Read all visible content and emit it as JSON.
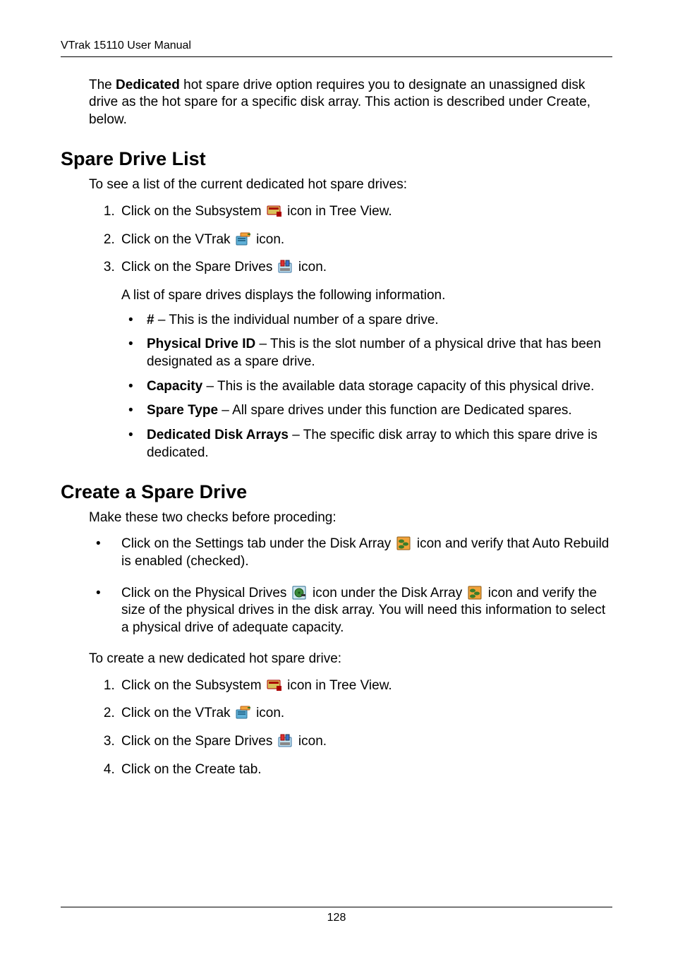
{
  "header": {
    "running_head": "VTrak 15110 User Manual"
  },
  "intro_para": {
    "text_before_bold": "The ",
    "bold": "Dedicated",
    "text_after_bold": " hot spare drive option requires you to designate an unassigned disk drive as the hot spare for a specific disk array. This action is described under Create, below."
  },
  "section1": {
    "heading": "Spare Drive List",
    "intro": "To see a list of the current dedicated hot spare drives:",
    "steps": [
      {
        "before": "Click on the Subsystem ",
        "icon": "subsystem-icon",
        "after": " icon in Tree View."
      },
      {
        "before": "Click on the VTrak ",
        "icon": "vtrak-icon",
        "after": " icon."
      },
      {
        "before": "Click on the Spare Drives ",
        "icon": "spare-drives-icon",
        "after": " icon."
      }
    ],
    "sub_para": "A list of spare drives displays the following information.",
    "bullets": [
      {
        "bold": "#",
        "rest": " – This is the individual number of a spare drive."
      },
      {
        "bold": "Physical Drive ID",
        "rest": " – This is the slot number of a physical drive that has been designated as a spare drive."
      },
      {
        "bold": "Capacity",
        "rest": " – This is the available data storage capacity of this physical drive."
      },
      {
        "bold": "Spare Type",
        "rest": " – All spare drives under this function are Dedicated spares."
      },
      {
        "bold": "Dedicated Disk Arrays",
        "rest": " – The specific disk array to which this spare drive is dedicated."
      }
    ]
  },
  "section2": {
    "heading": "Create a Spare Drive",
    "intro": "Make these two checks before proceding:",
    "checks": [
      {
        "seg1": "Click on the Settings tab under the Disk Array ",
        "icon1": "disk-array-icon",
        "seg2": " icon and verify that Auto Rebuild is enabled (checked)."
      },
      {
        "seg1": "Click on the Physical Drives ",
        "icon1": "physical-drives-icon",
        "seg2": " icon under the Disk Array ",
        "icon2": "disk-array-icon",
        "seg3": " icon and verify the size of the physical drives in the disk array. You will need this information to select a physical drive of adequate capacity."
      }
    ],
    "intro2": "To create a new dedicated hot spare drive:",
    "steps": [
      {
        "before": "Click on the Subsystem ",
        "icon": "subsystem-icon",
        "after": " icon in Tree View."
      },
      {
        "before": "Click on the VTrak ",
        "icon": "vtrak-icon",
        "after": " icon."
      },
      {
        "before": "Click on the Spare Drives ",
        "icon": "spare-drives-icon",
        "after": " icon."
      },
      {
        "before": "Click on the Create tab.",
        "icon": null,
        "after": ""
      }
    ]
  },
  "footer": {
    "page_number": "128"
  },
  "icons": {
    "subsystem-icon": "subsystem",
    "vtrak-icon": "vtrak",
    "spare-drives-icon": "spare-drives",
    "disk-array-icon": "disk-array",
    "physical-drives-icon": "physical-drives"
  }
}
